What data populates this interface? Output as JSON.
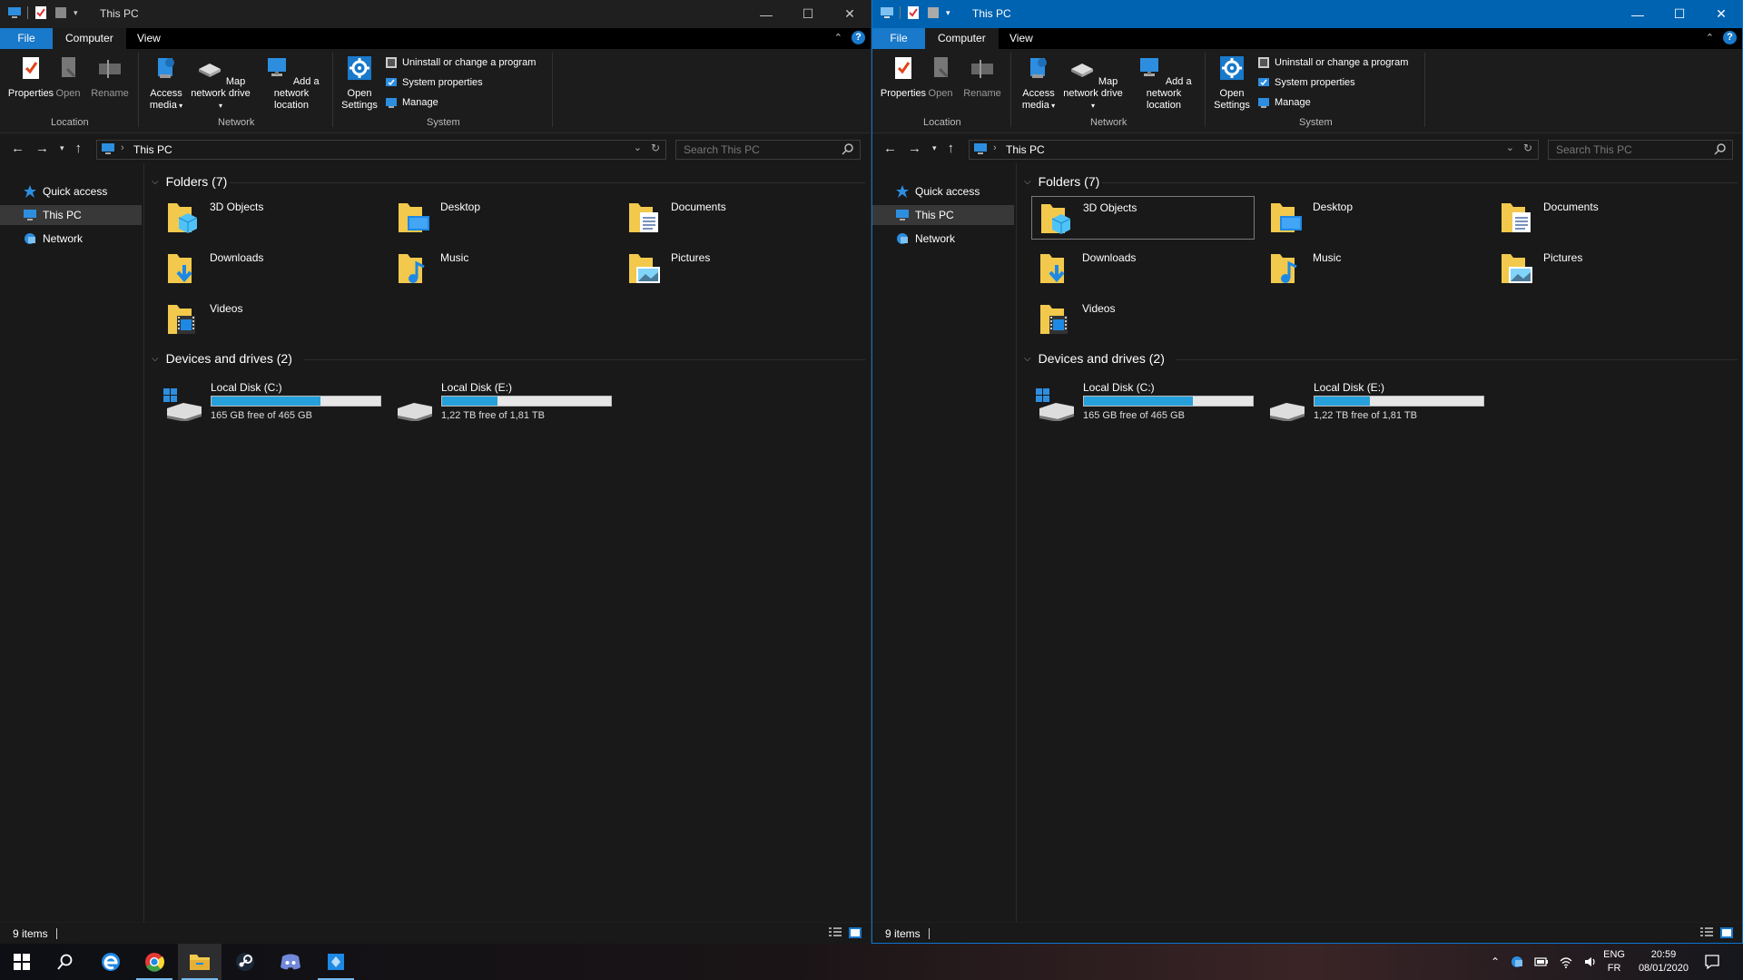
{
  "window_title": "This PC",
  "ribbon": {
    "tabs": [
      "File",
      "Computer",
      "View"
    ],
    "location": {
      "group_label": "Location",
      "properties": "Properties",
      "open": "Open",
      "rename": "Rename"
    },
    "network": {
      "group_label": "Network",
      "access_media": "Access media",
      "map_drive": "Map network drive",
      "add_location": "Add a network location"
    },
    "system": {
      "group_label": "System",
      "open_settings": "Open Settings",
      "uninstall": "Uninstall or change a program",
      "sys_props": "System properties",
      "manage": "Manage"
    },
    "help": "?"
  },
  "address": {
    "crumb": "This PC",
    "search_placeholder": "Search This PC"
  },
  "nav_pane": [
    "Quick access",
    "This PC",
    "Network"
  ],
  "folders_header": "Folders (7)",
  "folders": [
    "3D Objects",
    "Desktop",
    "Documents",
    "Downloads",
    "Music",
    "Pictures",
    "Videos"
  ],
  "drives_header": "Devices and drives (2)",
  "drives": [
    {
      "name": "Local Disk (C:)",
      "free": "165 GB free of 465 GB",
      "used_fraction": 0.645
    },
    {
      "name": "Local Disk (E:)",
      "free": "1,22 TB free of 1,81 TB",
      "used_fraction": 0.326
    }
  ],
  "status": {
    "items": "9 items"
  },
  "taskbar": {
    "lang_top": "ENG",
    "lang_bottom": "FR",
    "time": "20:59",
    "date": "08/01/2020"
  },
  "colors": {
    "accent": "#1979ca",
    "title_active": "#0063b1",
    "folder": "#f2c94c",
    "drive_fill": "#26a0da"
  }
}
